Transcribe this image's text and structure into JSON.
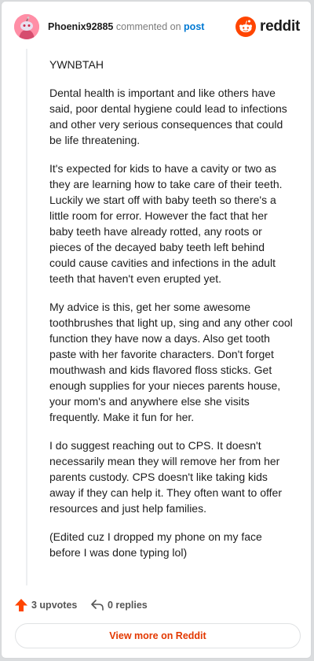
{
  "header": {
    "username": "Phoenix92885",
    "commented_on": "commented on",
    "post_link": "post",
    "brand": "reddit"
  },
  "comment": {
    "paragraphs": [
      "YWNBTAH",
      "Dental health is important and like others have said, poor dental hygiene could lead to infections and other very serious consequences that could be life threatening.",
      "It's expected for kids to have a cavity or two as they are learning how to take care of their teeth. Luckily we start off with baby teeth so there's a little room for error. However the fact that her baby teeth have already rotted, any roots or pieces of the decayed baby teeth left behind could cause cavities and infections in the adult teeth that haven't even erupted yet.",
      "My advice is this, get her some awesome toothbrushes that light up, sing and any other cool function they have now a days. Also get tooth paste with her favorite characters. Don't forget mouthwash and kids flavored floss sticks. Get enough supplies for your nieces parents house, your mom's and anywhere else she visits frequently. Make it fun for her.",
      "I do suggest reaching out to CPS. It doesn't necessarily mean they will remove her from her parents custody. CPS doesn't like taking kids away if they can help it. They often want to offer resources and just help families.",
      "(Edited cuz I dropped my phone on my face before I was done typing lol)"
    ]
  },
  "actions": {
    "upvotes": "3 upvotes",
    "replies": "0 replies"
  },
  "footer": {
    "view_more": "View more on Reddit"
  },
  "colors": {
    "brand_orange": "#ff4500",
    "link_blue": "#0079d3",
    "avatar_pink": "#ff8ea6"
  },
  "icons": {
    "avatar": "snoo-avatar-icon",
    "brand": "reddit-logo-icon",
    "upvote": "upvote-arrow-icon",
    "reply": "reply-arrow-icon"
  }
}
